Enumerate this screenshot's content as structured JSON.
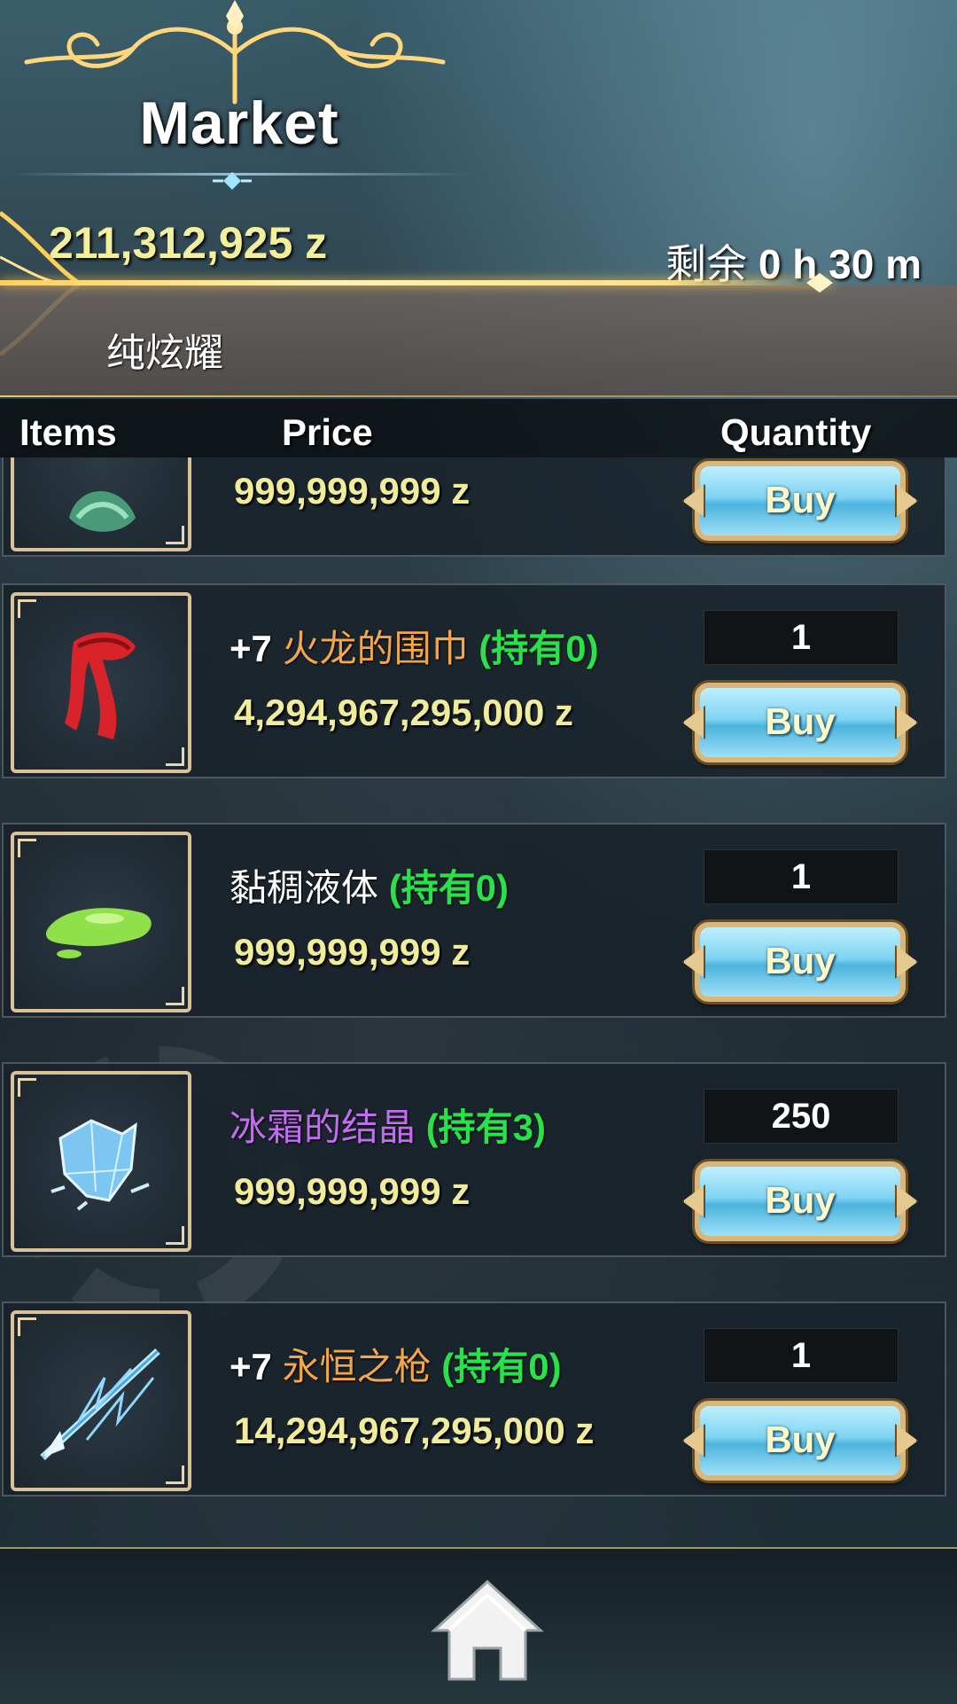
{
  "header": {
    "title": "Market",
    "gold": "211,312,925 z",
    "timer_label": "剩余",
    "timer_value": "0 h 30 m",
    "banner_text": "纯炫耀"
  },
  "columns": {
    "items": "Items",
    "price": "Price",
    "quantity": "Quantity"
  },
  "rows": [
    {
      "icon": "green-dragon-head-icon",
      "price": "999,999,999 z",
      "buy": "Buy"
    },
    {
      "icon": "red-scarf-icon",
      "plus": "+7",
      "name": "火龙的围巾",
      "name_color": "#f3a64a",
      "owned": "(持有0)",
      "price": "4,294,967,295,000 z",
      "quantity": "1",
      "buy": "Buy"
    },
    {
      "icon": "green-slime-icon",
      "name": "黏稠液体",
      "name_color": "#ffffff",
      "owned": "(持有0)",
      "price": "999,999,999 z",
      "quantity": "1",
      "buy": "Buy"
    },
    {
      "icon": "ice-crystal-icon",
      "name": "冰霜的结晶",
      "name_color": "#c26cf0",
      "owned": "(持有3)",
      "price": "999,999,999 z",
      "quantity": "250",
      "buy": "Buy"
    },
    {
      "icon": "lightning-spear-icon",
      "plus": "+7",
      "name": "永恒之枪",
      "name_color": "#f3a64a",
      "owned": "(持有0)",
      "price": "14,294,967,295,000 z",
      "quantity": "1",
      "buy": "Buy"
    }
  ],
  "footer": {
    "home_icon": "home-icon"
  }
}
